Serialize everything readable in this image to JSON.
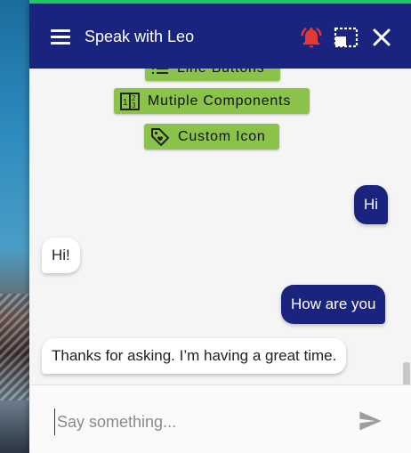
{
  "header": {
    "title": "Speak with Leo",
    "bell_icon": "bell-ringing-icon",
    "resize_icon": "resize-window-icon",
    "close_icon": "close-icon",
    "menu_icon": "menu-icon",
    "accent_color": "#21c55d",
    "bg_color": "#1a237e",
    "bell_color": "#e53935"
  },
  "chips": [
    {
      "label": "Line Buttons",
      "icon": "list-icon"
    },
    {
      "label": "Mutiple Components",
      "icon": "components-icon"
    },
    {
      "label": "Custom Icon",
      "icon": "tag-icon"
    }
  ],
  "messages": [
    {
      "sender": "user",
      "text": "Hi"
    },
    {
      "sender": "bot",
      "text": "Hi!"
    },
    {
      "sender": "user",
      "text": "How are you"
    },
    {
      "sender": "bot",
      "text": "Thanks for asking. I’m having a great time."
    }
  ],
  "composer": {
    "placeholder": "Say something...",
    "value": "",
    "send_icon": "send-icon"
  },
  "colors": {
    "chip_bg": "#8bc34a",
    "user_bubble": "#1a237e",
    "bot_bubble": "#ffffff"
  }
}
